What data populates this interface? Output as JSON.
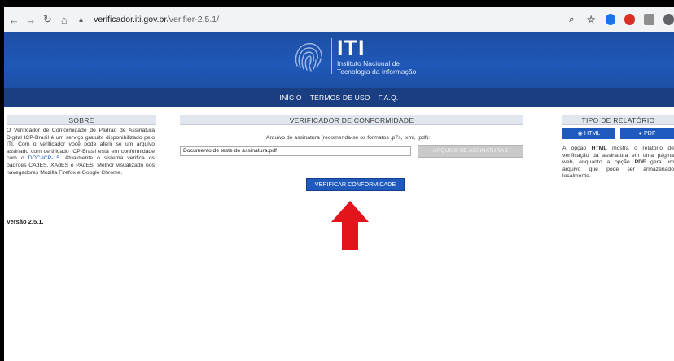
{
  "browser": {
    "url_host": "verificador.iti.gov.br",
    "url_path": "/verifier-2.5.1/",
    "extensions": [
      "zoom-icon",
      "star-icon",
      "chrome-ext-icon",
      "adblock-icon",
      "ext-icon",
      "profile-icon"
    ]
  },
  "header": {
    "logo_title": "ITI",
    "logo_sub_1": "Instituto Nacional de",
    "logo_sub_2": "Tecnologia da Informação"
  },
  "menu": {
    "items": [
      "INÍCIO",
      "TERMOS DE USO",
      "F.A.Q."
    ]
  },
  "sobre": {
    "title": "SOBRE",
    "text_before_link": "O Verificador de Conformidade do Padrão de Assinatura Digital ICP-Brasil é um serviço gratuito disponibilizado pelo ITI. Com o verificador você pode aferir se um arquivo assinado com certificado ICP-Brasil está em conformidade com o ",
    "link": "DOC-ICP-15",
    "text_after_link": ". Atualmente o sistema verifica os padrões CAdES, XAdES e PAdES. Melhor visualizado nos navegadores Mozilla Firefox e Google Chrome.",
    "version": "Versão 2.5.1."
  },
  "verificador": {
    "title": "VERIFICADOR DE CONFORMIDADE",
    "file_label": "Arquivo de assinatura (recomenda-se os formatos .p7s, .xml, .pdf):",
    "file_value": "Documento de teste de assinatura.pdf",
    "file_button": "ARQUIVO DE ASSINATURA 1",
    "verify_button": "VERIFICAR CONFORMIDADE"
  },
  "tipo": {
    "title": "TIPO DE RELATÓRIO",
    "html_label": "HTML",
    "pdf_label": "PDF",
    "text_1": "A opção ",
    "html_bold": "HTML",
    "text_2": " mostra o relatório de verificação da assinatura em uma página web, enquanto a opção ",
    "pdf_bold": "PDF",
    "text_3": " gera um arquivo que pode ser armazenado localmente."
  },
  "colors": {
    "header_blue": "#1f58b8",
    "menu_blue": "#1a3e82",
    "button_blue": "#1f5bbf",
    "arrow_red": "#e3141b"
  }
}
